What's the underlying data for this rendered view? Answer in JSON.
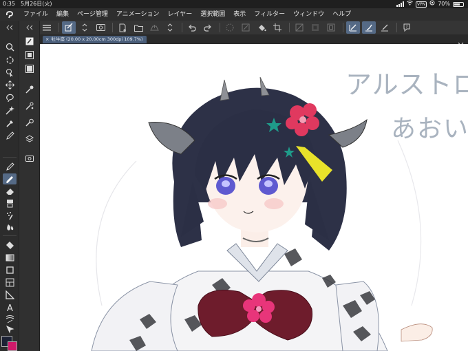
{
  "status_bar": {
    "time": "0:35",
    "date": "5月26日(火)",
    "vpn": "VPN",
    "battery": "70%",
    "battery_level": 0.7
  },
  "menu": {
    "items": [
      "ファイル",
      "編集",
      "ページ管理",
      "アニメーション",
      "レイヤー",
      "選択範囲",
      "表示",
      "フィルター",
      "ウィンドウ",
      "ヘルプ"
    ]
  },
  "canvas_tab": {
    "label": "牡牛座 (20.00 x 20.00cm 300dpi 109.7%)"
  },
  "canvas_text": {
    "line1": "アルストロ",
    "line2": "あおい"
  },
  "colors": {
    "main_color": "#1d2235",
    "sub_color": "#d01a6a",
    "accent": "#556a86"
  }
}
